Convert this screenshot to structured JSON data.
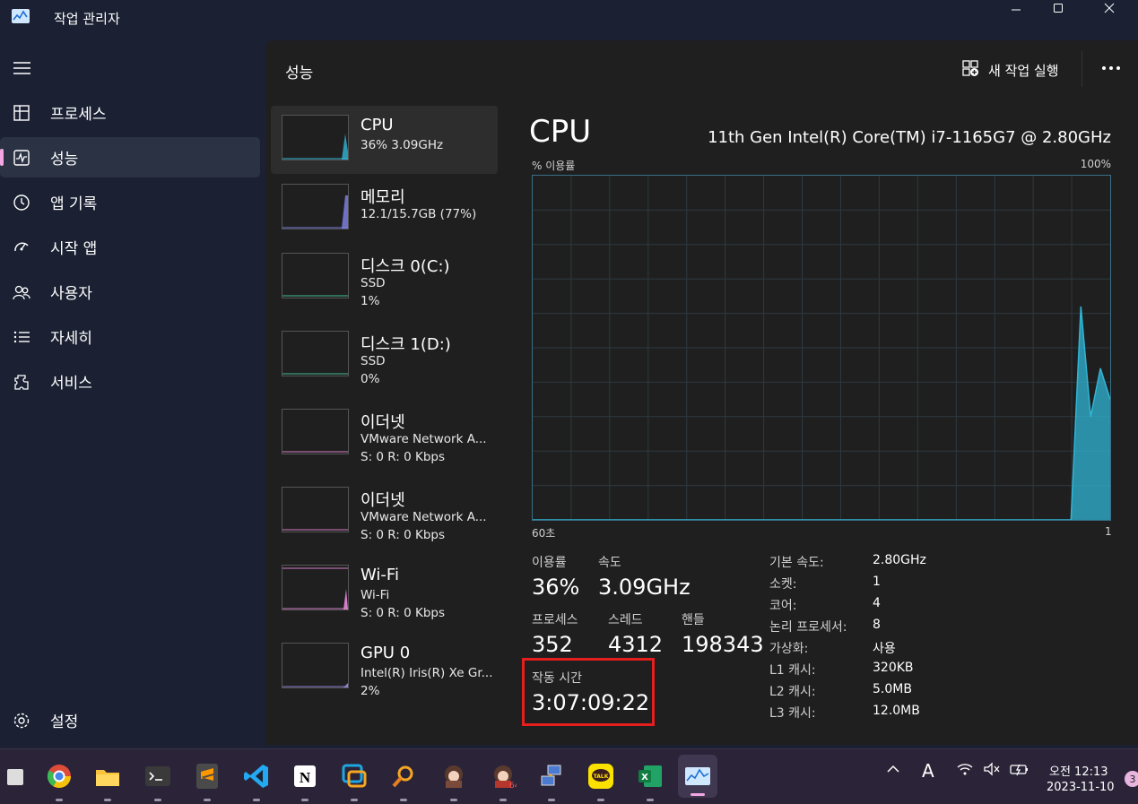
{
  "window": {
    "title": "작업 관리자"
  },
  "nav": {
    "items": [
      {
        "label": "프로세스",
        "icon": "processes-icon"
      },
      {
        "label": "성능",
        "icon": "performance-icon",
        "active": true
      },
      {
        "label": "앱 기록",
        "icon": "app-history-icon"
      },
      {
        "label": "시작 앱",
        "icon": "startup-apps-icon"
      },
      {
        "label": "사용자",
        "icon": "users-icon"
      },
      {
        "label": "자세히",
        "icon": "details-icon"
      },
      {
        "label": "서비스",
        "icon": "services-icon"
      }
    ],
    "settings_label": "설정"
  },
  "header": {
    "title": "성능",
    "run_task_label": "새 작업 실행"
  },
  "perf_list": [
    {
      "name": "CPU",
      "sub1": "36% 3.09GHz",
      "sub2": "",
      "color": "#30b5d6"
    },
    {
      "name": "메모리",
      "sub1": "12.1/15.7GB (77%)",
      "sub2": "",
      "color": "#7b7fe0"
    },
    {
      "name": "디스크 0(C:)",
      "sub1": "SSD",
      "sub2": "1%",
      "color": "#3fbf8f"
    },
    {
      "name": "디스크 1(D:)",
      "sub1": "SSD",
      "sub2": "0%",
      "color": "#3fbf8f"
    },
    {
      "name": "이더넷",
      "sub1": "VMware Network A...",
      "sub2": "S: 0 R: 0 Kbps",
      "color": "#d57fc7"
    },
    {
      "name": "이더넷",
      "sub1": "VMware Network A...",
      "sub2": "S: 0 R: 0 Kbps",
      "color": "#d57fc7"
    },
    {
      "name": "Wi-Fi",
      "sub1": "Wi-Fi",
      "sub2": "S: 0 R: 0 Kbps",
      "color": "#d57fc7"
    },
    {
      "name": "GPU 0",
      "sub1": "Intel(R) Iris(R) Xe Gr...",
      "sub2": "2%",
      "color": "#8a7fd0"
    }
  ],
  "detail": {
    "title": "CPU",
    "model": "11th Gen Intel(R) Core(TM) i7-1165G7 @ 2.80GHz",
    "util_label": "% 이용률",
    "util_max": "100%",
    "axis_left": "60초",
    "axis_right": "1",
    "stats": {
      "utilization_label": "이용률",
      "utilization": "36%",
      "speed_label": "속도",
      "speed": "3.09GHz",
      "processes_label": "프로세스",
      "processes": "352",
      "threads_label": "스레드",
      "threads": "4312",
      "handles_label": "핸들",
      "handles": "198343",
      "uptime_label": "작동 시간",
      "uptime": "3:07:09:22"
    },
    "specs": [
      {
        "k": "기본 속도:",
        "v": "2.80GHz"
      },
      {
        "k": "소켓:",
        "v": "1"
      },
      {
        "k": "코어:",
        "v": "4"
      },
      {
        "k": "논리 프로세서:",
        "v": "8"
      },
      {
        "k": "가상화:",
        "v": "사용"
      },
      {
        "k": "L1 캐시:",
        "v": "320KB"
      },
      {
        "k": "L2 캐시:",
        "v": "5.0MB"
      },
      {
        "k": "L3 캐시:",
        "v": "12.0MB"
      }
    ]
  },
  "chart_data": {
    "type": "area",
    "title": "",
    "ylabel": "% 이용률",
    "ylim": [
      0,
      100
    ],
    "x_labels": [
      "60초",
      "1"
    ],
    "series": [
      {
        "values": [
          0,
          0,
          0,
          0,
          0,
          0,
          0,
          0,
          0,
          0,
          0,
          0,
          0,
          0,
          0,
          0,
          0,
          0,
          0,
          0,
          0,
          0,
          0,
          0,
          0,
          0,
          0,
          0,
          0,
          0,
          0,
          0,
          0,
          0,
          0,
          0,
          0,
          0,
          0,
          0,
          0,
          0,
          0,
          0,
          0,
          0,
          0,
          0,
          0,
          0,
          0,
          0,
          0,
          0,
          0,
          0,
          62,
          30,
          44,
          35
        ]
      }
    ],
    "color": "#30b5d6"
  },
  "taskbar": {
    "apps": [
      "start-icon",
      "chrome-icon",
      "file-explorer-icon",
      "terminal-icon",
      "sublime-icon",
      "vscode-icon",
      "notion-icon",
      "remote-desktop-icon",
      "search-app-icon",
      "character-app-icon",
      "character-app-2-icon",
      "network-app-icon",
      "kakaotalk-icon",
      "excel-icon",
      "task-manager-icon"
    ],
    "time": "오전 12:13",
    "date": "2023-11-10",
    "ime": "A",
    "notif_count": "3"
  }
}
